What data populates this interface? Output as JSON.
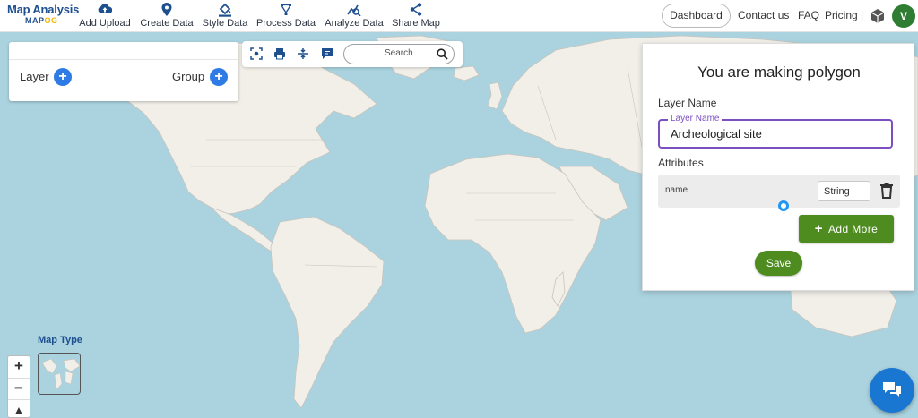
{
  "app": {
    "logo_title": "Map Analysis",
    "logo_sub_a": "MAP",
    "logo_sub_b": "OG"
  },
  "nav": {
    "items": [
      {
        "label": "Add Upload",
        "icon": "cloud-upload-icon"
      },
      {
        "label": "Create Data",
        "icon": "map-pin-icon"
      },
      {
        "label": "Style Data",
        "icon": "paint-bucket-icon"
      },
      {
        "label": "Process Data",
        "icon": "vector-path-icon"
      },
      {
        "label": "Analyze Data",
        "icon": "analyze-icon"
      },
      {
        "label": "Share Map",
        "icon": "share-icon"
      }
    ],
    "dashboard": "Dashboard",
    "contact": "Contact us",
    "faq": "FAQ",
    "pricing": "Pricing |",
    "avatar_initial": "V"
  },
  "layers": {
    "layer_label": "Layer",
    "group_label": "Group"
  },
  "toolbar": {
    "search_placeholder": "Search"
  },
  "dialog": {
    "title": "You are making polygon",
    "layer_name_label": "Layer Name",
    "field_legend": "Layer Name",
    "field_value": "Archeological site",
    "attributes_label": "Attributes",
    "attributes": [
      {
        "name": "name",
        "type": "String"
      }
    ],
    "add_more": "Add More",
    "save": "Save"
  },
  "map_type": {
    "label": "Map Type"
  },
  "colors": {
    "water": "#aad3df",
    "land": "#f2efe9",
    "primary_blue": "#2f7be5",
    "action_green": "#4e8c1f",
    "focus_purple": "#7b4fc0",
    "avatar_green": "#2e7d32"
  }
}
